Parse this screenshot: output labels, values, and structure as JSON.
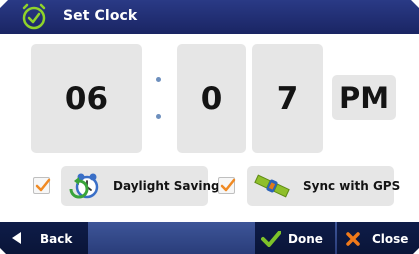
{
  "header": {
    "title": "Set Clock",
    "icon": "clock-icon"
  },
  "clock": {
    "hour": "06",
    "separator_icon": "colon-dots",
    "minute_tens": "0",
    "minute_ones": "7",
    "period": "PM"
  },
  "options": {
    "daylight": {
      "checked": true,
      "icon": "alarm-clock-icon",
      "label": "Daylight Saving"
    },
    "gps": {
      "checked": true,
      "icon": "satellite-icon",
      "label": "Sync with GPS"
    }
  },
  "footer": {
    "back_label": "Back",
    "done_label": "Done",
    "close_label": "Close"
  },
  "colors": {
    "titlebar": "#1f2c6e",
    "bottombar": "#3d5598",
    "button_dark": "#0e1c49",
    "panel": "#e6e6e6",
    "check_orange": "#f08a24",
    "done_green": "#7dc22a",
    "close_orange": "#f07a1a"
  }
}
